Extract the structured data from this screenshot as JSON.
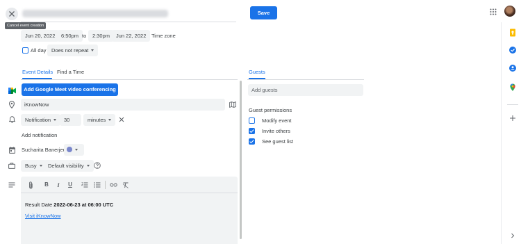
{
  "header": {
    "title_blurred": true,
    "save_label": "Save",
    "close_tooltip": "Cancel event creation"
  },
  "datetime": {
    "start_date": "Jun 20, 2022",
    "start_time": "6:50pm",
    "to": "to",
    "end_time": "2:30pm",
    "end_date": "Jun 22, 2022",
    "timezone_label": "Time zone",
    "all_day_label": "All day",
    "repeat_label": "Does not repeat"
  },
  "tabs": {
    "event_details": "Event Details",
    "find_time": "Find a Time"
  },
  "details": {
    "meet_button": "Add Google Meet video conferencing",
    "location_value": "iKnowNow",
    "notification_type": "Notification",
    "notification_amount": "30",
    "notification_unit": "minutes",
    "add_notification": "Add notification",
    "calendar_owner": "Sucharita Banerjee",
    "busy_label": "Busy",
    "visibility_label": "Default visibility",
    "description_prefix": "Result Date ",
    "description_date": "2022-06-23 at 06:00 UTC",
    "description_link": "Visit iKnowNow"
  },
  "editor": {
    "bold": "B",
    "italic": "I",
    "underline": "U"
  },
  "guests": {
    "tab_label": "Guests",
    "add_placeholder": "Add guests",
    "permissions_title": "Guest permissions",
    "permissions": [
      {
        "label": "Modify event",
        "checked": false
      },
      {
        "label": "Invite others",
        "checked": true
      },
      {
        "label": "See guest list",
        "checked": true
      }
    ]
  },
  "colors": {
    "accent": "#1a73e8",
    "meet_green": "#188038",
    "calendar_color": "#7986cb"
  },
  "icons": [
    "close-icon",
    "location-icon",
    "bell-icon",
    "calendar-icon",
    "briefcase-icon",
    "notes-icon",
    "map-icon",
    "help-icon",
    "apps-grid-icon",
    "attach-icon",
    "link-icon",
    "remove-format-icon"
  ]
}
